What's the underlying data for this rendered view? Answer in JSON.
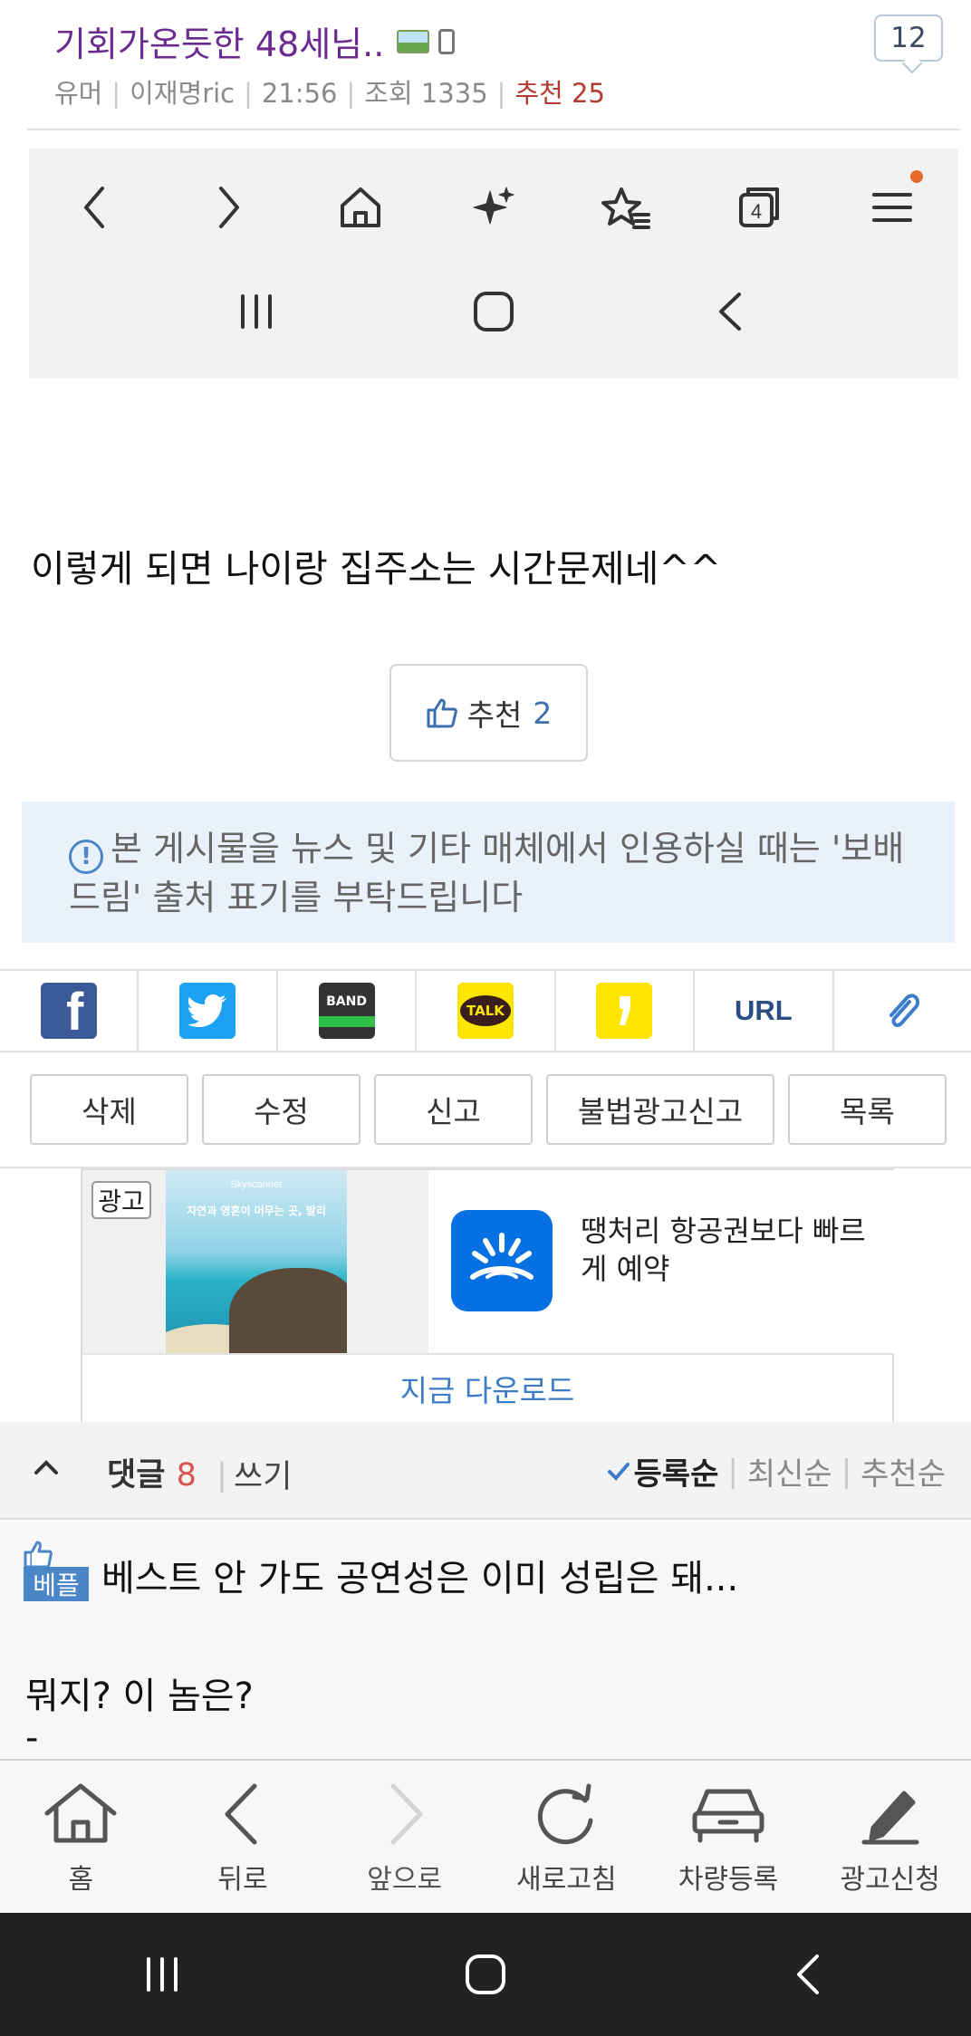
{
  "post": {
    "title": "기회가온듯한 48세님..",
    "meta": {
      "category": "유머",
      "author": "이재명ric",
      "time": "21:56",
      "views": "조회 1335",
      "recommend": "추천 25"
    },
    "comment_count": "12",
    "body": "이렇게 되면 나이랑 집주소는 시간문제네^^",
    "recommend_button": {
      "label": "추천",
      "count": "2"
    },
    "notice": "본 게시물을 뉴스 및 기타 매체에서 인용하실 때는 '보배드림' 출처 표기를 부탁드립니다"
  },
  "embedded_screenshot": {
    "icons": [
      "back-chevron-icon",
      "forward-chevron-icon",
      "home-icon",
      "sparkle-icon",
      "bookmark-star-icon",
      "tabs-icon",
      "menu-icon"
    ],
    "tabs_count": "4",
    "system_icons": [
      "recent-apps-icon",
      "home-circle-icon",
      "back-icon"
    ]
  },
  "share": {
    "items": [
      "facebook-icon",
      "twitter-icon",
      "band-icon",
      "kakaotalk-icon",
      "kakaostory-icon",
      "url-icon",
      "attach-icon"
    ],
    "band_label": "BAND",
    "talk_label": "TALK",
    "url_label": "URL"
  },
  "actions": {
    "delete": "삭제",
    "edit": "수정",
    "report": "신고",
    "report_ad": "불법광고신고",
    "list": "목록"
  },
  "ad": {
    "badge": "광고",
    "thumb_brand": "Skyscanner",
    "thumb_headline": "자연과 영혼이 머무는 곳, 발리",
    "copy": "땡처리 항공권보다 빠르게 예약",
    "cta": "지금 다운로드"
  },
  "comments": {
    "title": "댓글",
    "count": "8",
    "write": "쓰기",
    "sort": [
      "등록순",
      "최신순",
      "추천순"
    ],
    "best_badge": "베플",
    "best_text": "베스트 안 가도 공연성은 이미 성립은 돼...",
    "text": "뭐지? 이 놈은?",
    "dash": "-"
  },
  "toolbar": {
    "home": "홈",
    "back": "뒤로",
    "forward": "앞으로",
    "refresh": "새로고침",
    "car_register": "차량등록",
    "ad_apply": "광고신청"
  },
  "colors": {
    "title": "#6b2a8f",
    "recommend_meta": "#b23a2e",
    "accent_blue": "#3d7cc9",
    "notice_bg": "#e9f1fb"
  }
}
